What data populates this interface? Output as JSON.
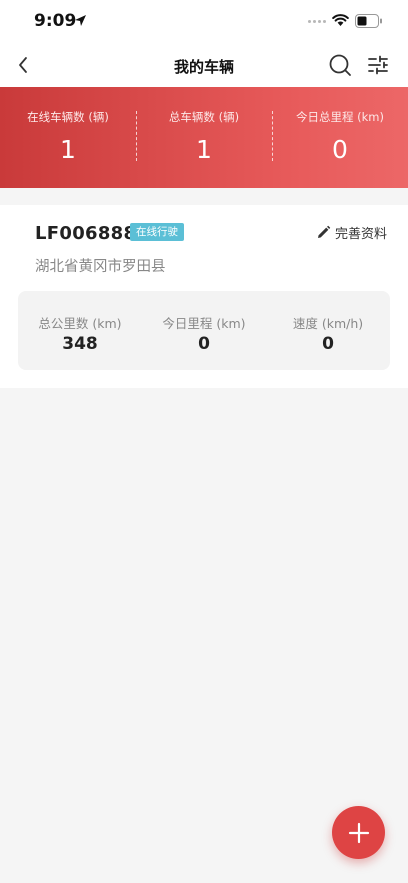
{
  "status_bar": {
    "time": "9:09"
  },
  "nav": {
    "title": "我的车辆"
  },
  "summary": [
    {
      "label": "在线车辆数 (辆)",
      "value": "1"
    },
    {
      "label": "总车辆数 (辆)",
      "value": "1"
    },
    {
      "label": "今日总里程 (km)",
      "value": "0"
    }
  ],
  "vehicle": {
    "plate": "LF006888",
    "status_badge": "在线行驶",
    "edit_label": "完善资料",
    "address": "湖北省黄冈市罗田县",
    "metrics": [
      {
        "label": "总公里数 (km)",
        "value": "348"
      },
      {
        "label": "今日里程 (km)",
        "value": "0"
      },
      {
        "label": "速度 (km/h)",
        "value": "0"
      }
    ]
  },
  "colors": {
    "accent": "#de4444",
    "badge": "#5bbfd6"
  },
  "icons": {
    "back": "chevron-left-icon",
    "search": "search-icon",
    "filter": "sliders-icon",
    "edit": "pencil-icon",
    "add": "plus-icon"
  }
}
